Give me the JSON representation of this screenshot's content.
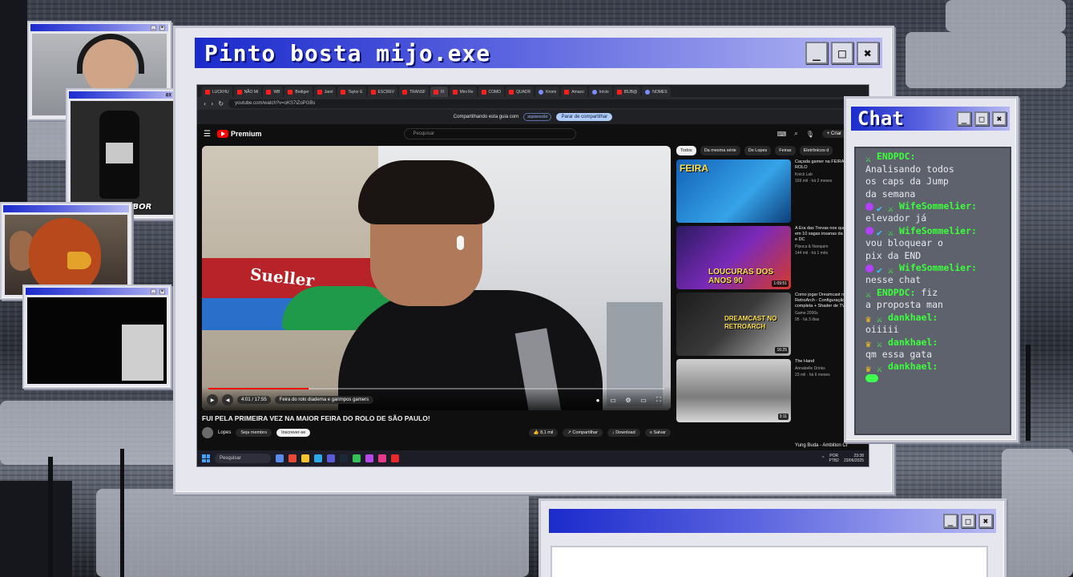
{
  "main_window": {
    "title": "Pinto bosta mijo.exe",
    "controls": {
      "minimize": "_",
      "maximize": "□",
      "close": "✖"
    }
  },
  "browser": {
    "tabs": [
      {
        "label": "LUCKHU"
      },
      {
        "label": "NÃO MI"
      },
      {
        "label": "WB"
      },
      {
        "label": "Bodiger"
      },
      {
        "label": "Jarel"
      },
      {
        "label": "Taylor E"
      },
      {
        "label": "ESCREV"
      },
      {
        "label": "TRANSF"
      },
      {
        "label": "FI",
        "active": true
      },
      {
        "label": "Mini Re"
      },
      {
        "label": "COMO"
      },
      {
        "label": "QUADR"
      },
      {
        "label": "Kromi"
      },
      {
        "label": "Amazo"
      },
      {
        "label": "Início"
      },
      {
        "label": "85JB@"
      },
      {
        "label": "NOMES"
      }
    ],
    "url": "youtube.com/watch?v=oKS7iZoPGBs",
    "sharing_message": "Compartilhando esta guia com",
    "sharing_target": "aquisessão",
    "stop_sharing": "Parar de compartilhar"
  },
  "youtube": {
    "logo": "Premium",
    "search_placeholder": "Pesquisar",
    "create": "Criar",
    "player": {
      "sign_text": "Sueller",
      "time": "4:01 / 17:55",
      "chapter": "Feira do rolo diadema e garimpos gamers",
      "progress": 0.22
    },
    "video_title": "FUI PELA PRIMEIRA VEZ NA MAIOR FEIRA DO ROLO DE SÃO PAULO!",
    "channel": "Lopes",
    "join_label": "Seja membro",
    "subscribe_label": "Inscrever-se",
    "actions": [
      "8,1 mil",
      "Compartilhar",
      "Download",
      "Salvar"
    ],
    "chips": [
      "Todos",
      "Da mesma série",
      "De Lopes",
      "Feiras",
      "Eletrônicos d"
    ],
    "recommendations": [
      {
        "title": "Caçada gamer na FEIRA DO ROLO",
        "channel": "Knick Lab",
        "meta": "169 mil · há 2 meses",
        "thumb_text": "FEIRA",
        "duration": ""
      },
      {
        "title": "A Era das Trevas nos quadrinhos em 10 sagas insanas da Marvel e DC",
        "channel": "Pipoca & Nanquim",
        "meta": "144 mil · há 1 mês",
        "thumb_text": "LOUCURAS DOS ANOS 90",
        "duration": "1:09:51"
      },
      {
        "title": "Como jogar Dreamcast no RetroArch - Configuração completa + Shader de TV",
        "channel": "Game 2000s",
        "meta": "95 · há 3 dias",
        "thumb_text": "DREAMCAST NO RETROARCH",
        "duration": "16:25"
      },
      {
        "title": "The Hand",
        "channel": "Annabelle Drinks",
        "meta": "23 mil · há 6 meses",
        "thumb_text": "",
        "duration": "3:11"
      }
    ],
    "next_up": "Yung Buda - Ambition Cr"
  },
  "taskbar": {
    "search": "Pesquisar",
    "lang": "POR",
    "layout": "PTB2",
    "time": "23:38",
    "date": "23/06/2025"
  },
  "chat_window": {
    "title": "Chat",
    "messages": [
      {
        "badges": [],
        "user": "",
        "lines": [
          "oiiiii"
        ]
      },
      {
        "badges": [
          "sword"
        ],
        "user": "ENDPDC:",
        "lines": [
          "Analisando todos",
          "os caps da Jump",
          "da semana"
        ]
      },
      {
        "badges": [
          "circle",
          "check",
          "sword"
        ],
        "user": "WifeSommelier:",
        "lines": [
          "elevador já"
        ]
      },
      {
        "badges": [
          "circle",
          "check",
          "sword"
        ],
        "user": "WifeSommelier:",
        "lines": [
          "vou bloquear o",
          "pix da END"
        ]
      },
      {
        "badges": [
          "circle",
          "check",
          "sword"
        ],
        "user": "WifeSommelier:",
        "lines": [
          "nesse chat"
        ]
      },
      {
        "badges": [
          "sword"
        ],
        "user": "ENDPDC:",
        "lines": [
          "fiz",
          "a proposta man"
        ]
      },
      {
        "badges": [
          "crown",
          "sword"
        ],
        "user": "dankhael:",
        "lines": [
          "oiiiii"
        ]
      },
      {
        "badges": [
          "crown",
          "sword"
        ],
        "user": "dankhael:",
        "lines": [
          "qm essa gata"
        ]
      },
      {
        "badges": [
          "crown",
          "sword"
        ],
        "user": "dankhael:",
        "lines": [
          "[emote]"
        ]
      }
    ]
  },
  "webcams": {
    "cam1_corner": "",
    "cam2_corner": "0X",
    "cam2_caption": "Tung Tung saBOR"
  },
  "colors": {
    "titlebar_start": "#1b2bcc",
    "titlebar_end": "#b6b9f2",
    "chat_name": "#3cff3c",
    "youtube_red": "#ff0000"
  }
}
